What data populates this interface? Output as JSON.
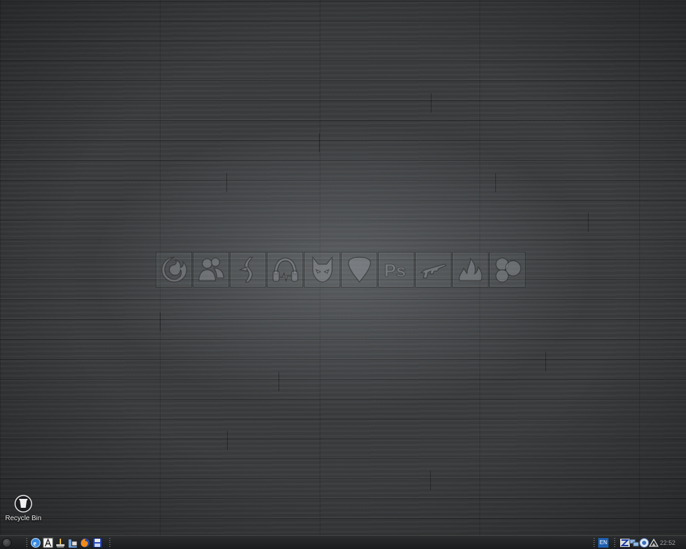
{
  "desktop": {
    "icons": [
      {
        "label": "Recycle Bin",
        "icon": "recycle-bin-icon"
      }
    ],
    "dock": [
      {
        "icon": "firefox-icon"
      },
      {
        "icon": "messenger-icon"
      },
      {
        "icon": "music-player-icon"
      },
      {
        "icon": "headphones-icon"
      },
      {
        "icon": "fox-mask-icon"
      },
      {
        "icon": "guitar-pick-icon"
      },
      {
        "icon": "photoshop-icon",
        "text": "Ps"
      },
      {
        "icon": "rifle-icon"
      },
      {
        "icon": "fire-icon"
      },
      {
        "icon": "circles-icon"
      }
    ]
  },
  "taskbar": {
    "quick_launch": [
      {
        "icon": "internet-explorer-icon"
      },
      {
        "icon": "text-editor-icon"
      },
      {
        "icon": "paint-icon"
      },
      {
        "icon": "files-icon"
      },
      {
        "icon": "firefox-icon"
      },
      {
        "icon": "save-icon"
      }
    ],
    "tray": {
      "language": "EN",
      "icons": [
        {
          "icon": "zonealarm-icon"
        },
        {
          "icon": "network-icon"
        },
        {
          "icon": "update-icon"
        },
        {
          "icon": "signal-icon"
        }
      ],
      "clock": "22:52"
    }
  },
  "colors": {
    "taskbar_bg": "#1f2022",
    "lang_badge": "#1f5fb0",
    "clock_text": "#9a9da0"
  }
}
